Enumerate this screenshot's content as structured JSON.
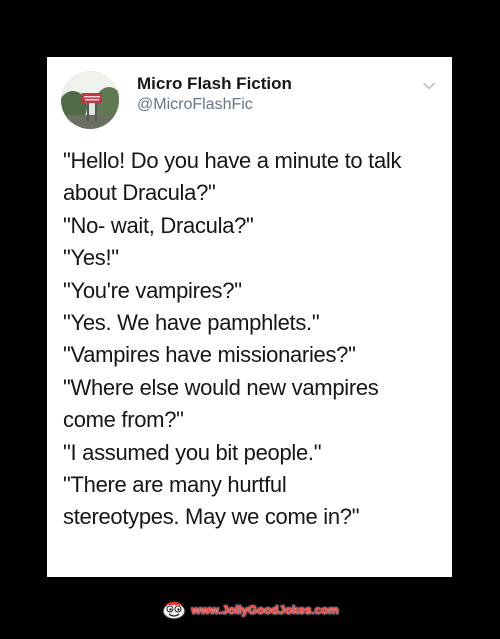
{
  "tweet": {
    "display_name": "Micro Flash Fiction",
    "handle": "@MicroFlashFic",
    "avatar_icon": "sign-photo-avatar",
    "menu_icon": "chevron-down-icon",
    "lines": [
      "\"Hello! Do you have a minute to talk",
      "about Dracula?\"",
      "\"No- wait, Dracula?\"",
      "\"Yes!\"",
      "\"You're vampires?\"",
      "\"Yes. We have pamphlets.\"",
      "\"Vampires have missionaries?\"",
      "\"Where else would new vampires",
      "come from?\"",
      "\"I assumed you bit people.\"",
      "\"There are many hurtful",
      "stereotypes. May we come in?\""
    ]
  },
  "watermark": {
    "text": "www.JollyGoodJokes.com",
    "logo_icon": "jolly-mascot-logo"
  },
  "colors": {
    "background": "#000000",
    "card": "#ffffff",
    "text": "#14171a",
    "handle": "#657786",
    "watermark": "#ff3b3b"
  }
}
